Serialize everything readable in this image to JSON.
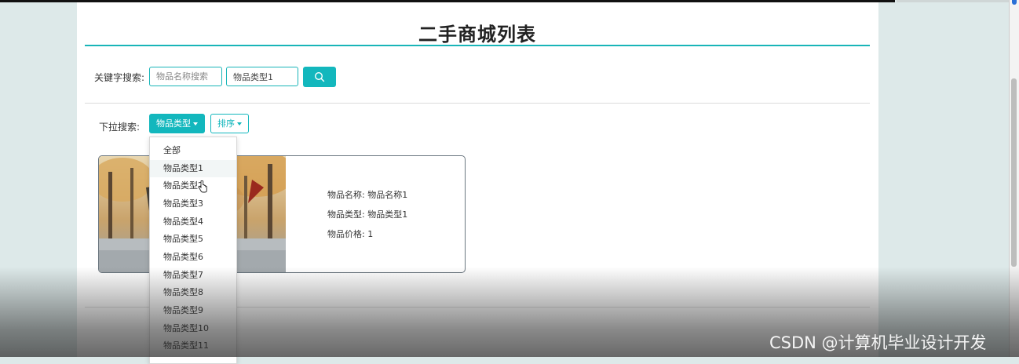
{
  "page": {
    "title": "二手商城列表"
  },
  "search": {
    "label": "关键字搜索:",
    "name_placeholder": "物品名称搜索",
    "type_value": "物品类型1"
  },
  "filter": {
    "label": "下拉搜索:",
    "type_button": "物品类型",
    "sort_button": "排序"
  },
  "dropdown": {
    "items": [
      "全部",
      "物品类型1",
      "物品类型2",
      "物品类型3",
      "物品类型4",
      "物品类型5",
      "物品类型6",
      "物品类型7",
      "物品类型8",
      "物品类型9",
      "物品类型10",
      "物品类型11"
    ]
  },
  "product": {
    "name": "物品名称: 物品名称1",
    "type": "物品类型: 物品类型1",
    "price": "物品价格: 1"
  },
  "watermark": "CSDN @计算机毕业设计开发",
  "colors": {
    "accent": "#13b7bd",
    "page_background": "#dde9e9"
  },
  "icons": {
    "search": "search-icon",
    "cursor": "hand-cursor-icon"
  }
}
